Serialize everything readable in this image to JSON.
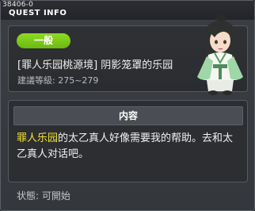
{
  "window": {
    "id": "38406-0",
    "title": "QUEST INFO"
  },
  "quest": {
    "status_badge": "一般",
    "name": "[罪人乐园桃源境] 阴影笼罩的乐园",
    "level": "建議等級: 275~279"
  },
  "content": {
    "header": "内容",
    "highlight": "罪人乐园",
    "text": "的太乙真人好像需要我的帮助。去和太乙真人对话吧。"
  },
  "footer": {
    "status": "状態:  可開始"
  },
  "colors": {
    "badge": "#7bc81a",
    "highlight": "#f3e533",
    "background": "#3b3e43"
  }
}
